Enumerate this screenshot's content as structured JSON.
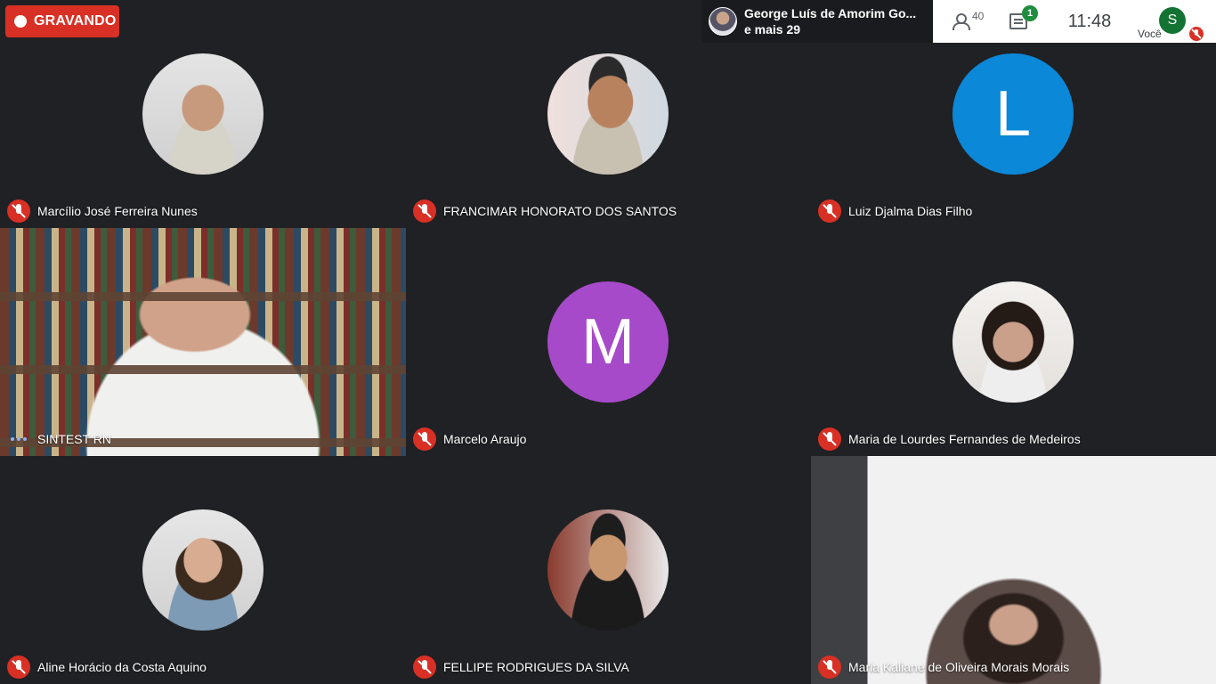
{
  "recording": {
    "label": "GRAVANDO"
  },
  "presenter": {
    "name": "George Luís de Amorim Go...",
    "more": "e mais 29"
  },
  "controls": {
    "people_count": "40",
    "chat_badge": "1",
    "clock": "11:48",
    "self_initial": "S",
    "self_label": "Você"
  },
  "tiles": [
    {
      "name": "Marcílio José Ferreira Nunes",
      "avatar": "photo",
      "muted": true
    },
    {
      "name": "FRANCIMAR HONORATO DOS SANTOS",
      "avatar": "photo",
      "muted": true
    },
    {
      "name": "Luiz Djalma Dias Filho",
      "avatar": "letter",
      "initial": "L",
      "color": "#0b88d8",
      "muted": true
    },
    {
      "name": "SINTEST RN",
      "avatar": "video",
      "muted": false,
      "speaking": true
    },
    {
      "name": "Marcelo Araujo",
      "avatar": "letter",
      "initial": "M",
      "color": "#a64ac9",
      "muted": true
    },
    {
      "name": "Maria de Lourdes Fernandes de Medeiros",
      "avatar": "photo",
      "muted": true
    },
    {
      "name": "Aline Horácio da Costa Aquino",
      "avatar": "photo",
      "muted": true
    },
    {
      "name": "FELLIPE RODRIGUES DA SILVA",
      "avatar": "photo",
      "muted": true
    },
    {
      "name": "Maria Kaliane de Oliveira Morais Morais",
      "avatar": "video",
      "muted": true
    }
  ],
  "colors": {
    "background": "#202124",
    "record_red": "#d93025",
    "chat_green": "#1e8e3e",
    "self_avatar": "#137333"
  }
}
